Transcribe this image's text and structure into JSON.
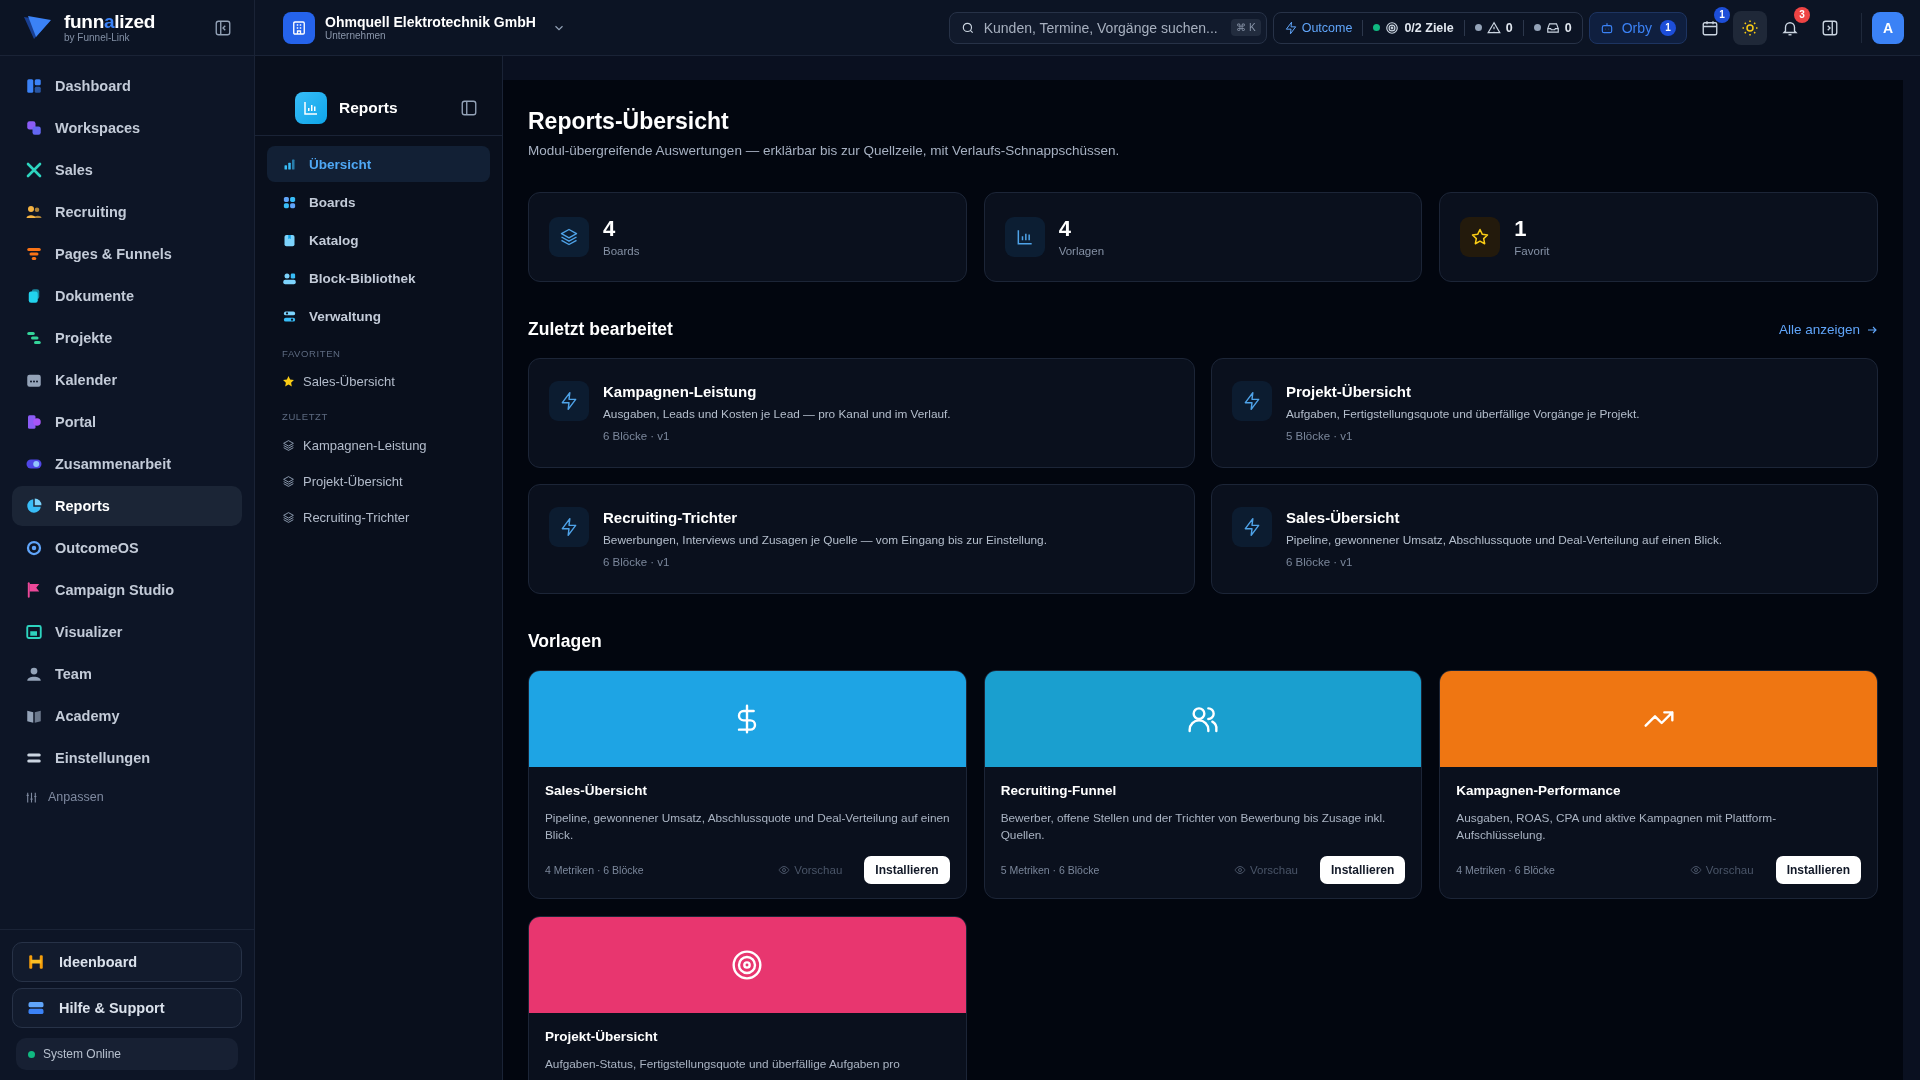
{
  "brand": {
    "parts": [
      "funn",
      "a",
      "lized"
    ],
    "tagline": "by Funnel-Link"
  },
  "company": {
    "name": "Ohmquell Elektrotechnik GmbH",
    "subtitle": "Unternehmen"
  },
  "search": {
    "placeholder": "Kunden, Termine, Vorgänge suchen...",
    "shortcut": "⌘ K"
  },
  "status": {
    "outcome": "Outcome",
    "goals": "0/2 Ziele",
    "warnings": "0",
    "inbox": "0"
  },
  "orby": {
    "label": "Orby",
    "badge": "1"
  },
  "toolbar": {
    "calendar_badge": "1",
    "theme_active": true,
    "notifications_badge": "3",
    "avatar": "A"
  },
  "nav": [
    {
      "label": "Dashboard",
      "selected": false
    },
    {
      "label": "Workspaces",
      "selected": false
    },
    {
      "label": "Sales",
      "selected": false
    },
    {
      "label": "Recruiting",
      "selected": false
    },
    {
      "label": "Pages & Funnels",
      "selected": false
    },
    {
      "label": "Dokumente",
      "selected": false
    },
    {
      "label": "Projekte",
      "selected": false
    },
    {
      "label": "Kalender",
      "selected": false
    },
    {
      "label": "Portal",
      "selected": false
    },
    {
      "label": "Zusammenarbeit",
      "selected": false
    },
    {
      "label": "Reports",
      "selected": true
    },
    {
      "label": "OutcomeOS",
      "selected": false
    },
    {
      "label": "Campaign Studio",
      "selected": false
    },
    {
      "label": "Visualizer",
      "selected": false
    },
    {
      "label": "Team",
      "selected": false
    },
    {
      "label": "Academy",
      "selected": false
    },
    {
      "label": "Einstellungen",
      "selected": false
    }
  ],
  "customize": "Anpassen",
  "bottom_links": [
    "Ideenboard",
    "Hilfe & Support"
  ],
  "system_status": "System Online",
  "subnav": {
    "title": "Reports",
    "items": [
      {
        "label": "Übersicht",
        "selected": true
      },
      {
        "label": "Boards",
        "selected": false
      },
      {
        "label": "Katalog",
        "selected": false
      },
      {
        "label": "Block-Bibliothek",
        "selected": false
      },
      {
        "label": "Verwaltung",
        "selected": false
      }
    ],
    "favorites_heading": "FAVORITEN",
    "favorites": [
      "Sales-Übersicht"
    ],
    "recent_heading": "ZULETZT",
    "recent": [
      "Kampagnen-Leistung",
      "Projekt-Übersicht",
      "Recruiting-Trichter"
    ]
  },
  "page": {
    "title": "Reports-Übersicht",
    "subtitle": "Modul-übergreifende Auswertungen — erklärbar bis zur Quellzeile, mit Verlaufs-Schnappschüssen."
  },
  "stats": [
    {
      "kind": "boards",
      "value": "4",
      "label": "Boards"
    },
    {
      "kind": "templates",
      "value": "4",
      "label": "Vorlagen"
    },
    {
      "kind": "favorites",
      "value": "1",
      "label": "Favorit"
    }
  ],
  "recent": {
    "heading": "Zuletzt bearbeitet",
    "view_all": "Alle anzeigen",
    "items": [
      {
        "title": "Kampagnen-Leistung",
        "description": "Ausgaben, Leads und Kosten je Lead — pro Kanal und im Verlauf.",
        "meta": "6 Blöcke · v1"
      },
      {
        "title": "Projekt-Übersicht",
        "description": "Aufgaben, Fertigstellungsquote und überfällige Vorgänge je Projekt.",
        "meta": "5 Blöcke · v1"
      },
      {
        "title": "Recruiting-Trichter",
        "description": "Bewerbungen, Interviews und Zusagen je Quelle — vom Eingang bis zur Einstellung.",
        "meta": "6 Blöcke · v1"
      },
      {
        "title": "Sales-Übersicht",
        "description": "Pipeline, gewonnener Umsatz, Abschlussquote und Deal-Verteilung auf einen Blick.",
        "meta": "6 Blöcke · v1"
      }
    ]
  },
  "templates": {
    "heading": "Vorlagen",
    "items": [
      {
        "kind": "dollar",
        "color": "#1ea4e4",
        "title": "Sales-Übersicht",
        "description": "Pipeline, gewonnener Umsatz, Abschlussquote und Deal-Verteilung auf einen Blick.",
        "meta": "4 Metriken · 6 Blöcke",
        "preview": "Vorschau",
        "install": "Installieren"
      },
      {
        "kind": "users",
        "color": "#1a9fcf",
        "title": "Recruiting-Funnel",
        "description": "Bewerber, offene Stellen und der Trichter von Bewerbung bis Zusage inkl. Quellen.",
        "meta": "5 Metriken · 6 Blöcke",
        "preview": "Vorschau",
        "install": "Installieren"
      },
      {
        "kind": "trend",
        "color": "#ef7612",
        "title": "Kampagnen-Performance",
        "description": "Ausgaben, ROAS, CPA und aktive Kampagnen mit Plattform-Aufschlüsselung.",
        "meta": "4 Metriken · 6 Blöcke",
        "preview": "Vorschau",
        "install": "Installieren"
      },
      {
        "kind": "target",
        "color": "#e8366f",
        "title": "Projekt-Übersicht",
        "description": "Aufgaben-Status, Fertigstellungsquote und überfällige Aufgaben pro"
      }
    ]
  }
}
